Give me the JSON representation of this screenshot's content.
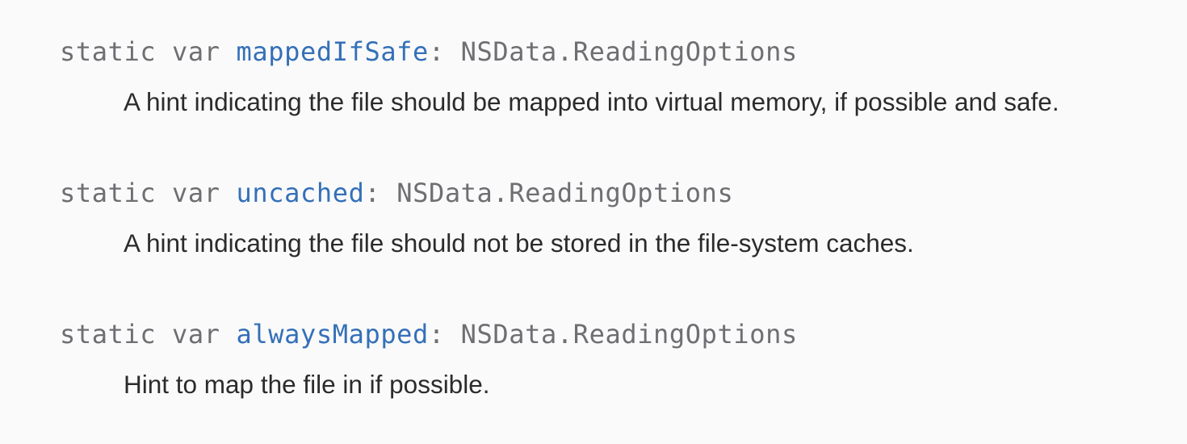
{
  "topics": [
    {
      "keyword": "static var",
      "name": "mappedIfSafe",
      "separator": ":",
      "type": "NSData.ReadingOptions",
      "abstract": "A hint indicating the file should be mapped into virtual memory, if possible and safe."
    },
    {
      "keyword": "static var",
      "name": "uncached",
      "separator": ":",
      "type": "NSData.ReadingOptions",
      "abstract": "A hint indicating the file should not be stored in the file-system caches."
    },
    {
      "keyword": "static var",
      "name": "alwaysMapped",
      "separator": ":",
      "type": "NSData.ReadingOptions",
      "abstract": "Hint to map the file in if possible."
    }
  ],
  "colors": {
    "background": "#fafafa",
    "keyword": "#6e6e73",
    "link": "#3470b8",
    "text": "#2b2b2b"
  }
}
